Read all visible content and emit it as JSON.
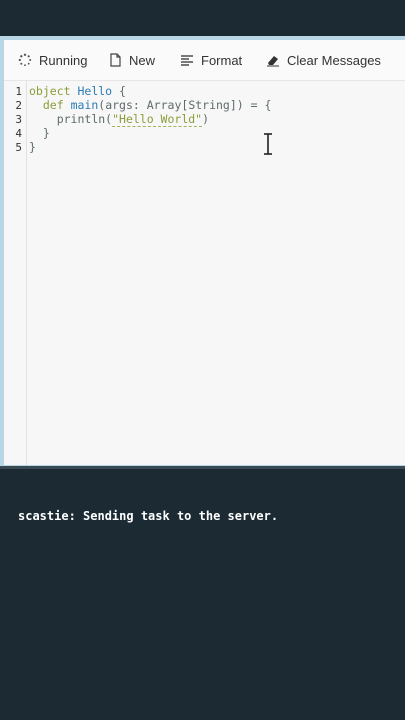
{
  "toolbar": {
    "running_label": "Running",
    "new_label": "New",
    "format_label": "Format",
    "clear_label": "Clear Messages",
    "icons": [
      "spinner-icon",
      "new-file-icon",
      "format-icon",
      "eraser-icon"
    ]
  },
  "editor": {
    "line_numbers": [
      "1",
      "2",
      "3",
      "4",
      "5"
    ],
    "lines": {
      "l1": {
        "a": "object",
        "b": "Hello",
        "c": "{"
      },
      "l2": {
        "a": "def",
        "b": "main",
        "c": "(args: ",
        "d": "Array",
        "e": "[",
        "f": "String",
        "g": "]) = {"
      },
      "l3": {
        "a": "println(",
        "b": "\"Hello World\"",
        "c": ")"
      },
      "l4": {
        "a": "}"
      },
      "l5": {
        "a": "}"
      }
    }
  },
  "console": {
    "message": "scastie: Sending task to the server."
  },
  "colors": {
    "background": "#1b2a33",
    "keyword": "#8a9d3a",
    "type": "#2b7cb5",
    "frame": "#b9d6e6"
  }
}
